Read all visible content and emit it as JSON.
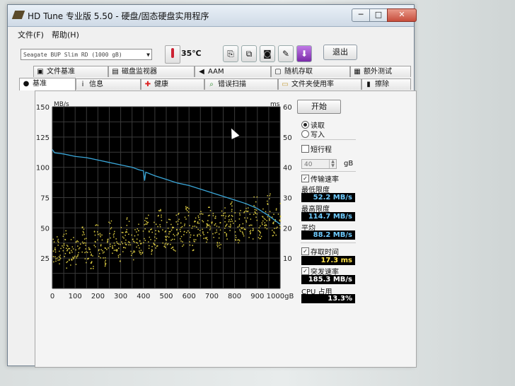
{
  "window": {
    "title": "HD Tune 专业版 5.50 - 硬盘/固态硬盘实用程序",
    "min_label": "─",
    "max_label": "□",
    "close_label": "✕"
  },
  "menu": [
    "文件(F)",
    "帮助(H)"
  ],
  "toolbar": {
    "drive": "Seagate BUP Slim RD (1000 gB)",
    "temperature": "35℃",
    "exit_label": "退出",
    "icons": [
      "copy-icon",
      "copy-screen-icon",
      "camera-icon",
      "options-icon",
      "download-icon"
    ]
  },
  "tabs_back": [
    {
      "label": "文件基准",
      "icon": "file-benchmark-icon",
      "glyph": "▣"
    },
    {
      "label": "磁盘监视器",
      "icon": "disk-monitor-icon",
      "glyph": "▤"
    },
    {
      "label": "AAM",
      "icon": "speaker-icon",
      "glyph": "◀"
    },
    {
      "label": "随机存取",
      "icon": "random-access-icon",
      "glyph": "▢"
    },
    {
      "label": "额外测试",
      "icon": "extra-tests-icon",
      "glyph": "▦"
    }
  ],
  "tabs_front": [
    {
      "label": "基准",
      "icon": "benchmark-icon",
      "glyph": "●"
    },
    {
      "label": "信息",
      "icon": "info-icon",
      "glyph": "i"
    },
    {
      "label": "健康",
      "icon": "health-icon",
      "glyph": "✚"
    },
    {
      "label": "错误扫描",
      "icon": "error-scan-icon",
      "glyph": "⌕"
    },
    {
      "label": "文件夹使用率",
      "icon": "folder-icon",
      "glyph": "▭"
    },
    {
      "label": "擦除",
      "icon": "erase-icon",
      "glyph": "▮"
    }
  ],
  "controls": {
    "start_label": "开始",
    "read_label": "读取",
    "write_label": "写入",
    "short_stroke_label": "短行程",
    "short_stroke_value": "40",
    "short_stroke_unit": "gB",
    "transfer_rate_label": "传输速率",
    "min_label": "最低限度",
    "min_value": "52.2 MB/s",
    "max_label": "最高限度",
    "max_value": "114.7 MB/s",
    "avg_label": "平均",
    "avg_value": "88.2 MB/s",
    "access_time_label": "存取时间",
    "access_time_value": "17.3 ms",
    "burst_rate_label": "突发速率",
    "burst_rate_value": "185.3 MB/s",
    "cpu_label": "CPU 占用",
    "cpu_value": "13.3%"
  },
  "chart_data": {
    "type": "line",
    "x_unit_label": "1000gB",
    "y_left_label": "MB/s",
    "y_right_label": "ms",
    "xlim": [
      0,
      1000
    ],
    "ylim_left": [
      0,
      150
    ],
    "ylim_right": [
      0,
      60
    ],
    "x_ticks": [
      "0",
      "100",
      "200",
      "300",
      "400",
      "500",
      "600",
      "700",
      "800",
      "900"
    ],
    "y_left_ticks": [
      "25",
      "50",
      "75",
      "100",
      "125",
      "150"
    ],
    "y_right_ticks": [
      "10",
      "20",
      "30",
      "40",
      "50",
      "60"
    ],
    "grid": true,
    "colors": {
      "background": "#000000",
      "grid": "#3a3a3a",
      "transfer": "#3aa6d8",
      "access": "#d8c840"
    },
    "series": [
      {
        "name": "传输速率",
        "axis": "left",
        "x": [
          0,
          10,
          50,
          100,
          150,
          200,
          250,
          300,
          350,
          380,
          400,
          405,
          410,
          450,
          500,
          550,
          600,
          650,
          700,
          750,
          800,
          850,
          900,
          950,
          1000
        ],
        "values": [
          114.7,
          112,
          111,
          109,
          108,
          106,
          104,
          102,
          100,
          98,
          97,
          89,
          96,
          93,
          90,
          87,
          85,
          82,
          79,
          76,
          73,
          70,
          66,
          60,
          53
        ]
      },
      {
        "name": "存取时间",
        "axis": "right",
        "type": "scatter",
        "x": [
          10,
          30,
          50,
          70,
          90,
          110,
          130,
          150,
          170,
          190,
          210,
          230,
          250,
          270,
          290,
          310,
          330,
          350,
          370,
          390,
          410,
          430,
          450,
          470,
          490,
          510,
          530,
          550,
          570,
          590,
          610,
          630,
          650,
          670,
          690,
          710,
          730,
          750,
          770,
          790,
          810,
          830,
          850,
          870,
          890,
          910,
          930,
          950,
          970,
          990
        ],
        "values": [
          13,
          12,
          15,
          10,
          14,
          12,
          16,
          13,
          11,
          17,
          14,
          12,
          18,
          15,
          13,
          16,
          19,
          14,
          17,
          15,
          20,
          16,
          18,
          22,
          17,
          19,
          16,
          21,
          18,
          23,
          17,
          20,
          22,
          19,
          24,
          21,
          18,
          23,
          20,
          25,
          19,
          22,
          24,
          21,
          26,
          20,
          23,
          27,
          22,
          24
        ]
      }
    ]
  }
}
